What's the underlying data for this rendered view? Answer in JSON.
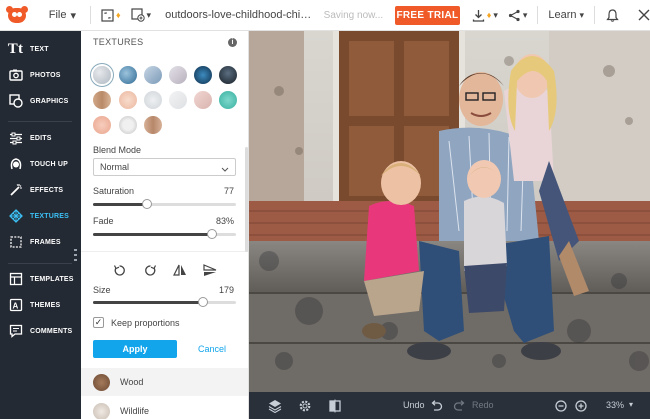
{
  "topbar": {
    "file_label": "File",
    "document_name": "outdoors-love-childhood-child-family...",
    "status": "Saving now...",
    "free_trial_label": "FREE TRIAL",
    "learn_label": "Learn"
  },
  "leftnav": {
    "items": [
      {
        "label": "TEXT",
        "icon": "text-icon",
        "active": false
      },
      {
        "label": "PHOTOS",
        "icon": "photos-icon",
        "active": false
      },
      {
        "label": "GRAPHICS",
        "icon": "graphics-icon",
        "active": false
      },
      {
        "label": "EDITS",
        "icon": "sliders-icon",
        "active": false
      },
      {
        "label": "TOUCH UP",
        "icon": "face-icon",
        "active": false
      },
      {
        "label": "EFFECTS",
        "icon": "wand-icon",
        "active": false
      },
      {
        "label": "TEXTURES",
        "icon": "textures-icon",
        "active": true
      },
      {
        "label": "FRAMES",
        "icon": "frame-icon",
        "active": false
      },
      {
        "label": "TEMPLATES",
        "icon": "templates-icon",
        "active": false
      },
      {
        "label": "THEMES",
        "icon": "themes-icon",
        "active": false
      },
      {
        "label": "COMMENTS",
        "icon": "comments-icon",
        "active": false
      }
    ]
  },
  "panel": {
    "title": "TEXTURES",
    "blend_mode_label": "Blend Mode",
    "blend_mode_value": "Normal",
    "saturation_label": "Saturation",
    "saturation_value": "77",
    "saturation_fraction": 0.38,
    "fade_label": "Fade",
    "fade_value": "83%",
    "fade_fraction": 0.83,
    "size_label": "Size",
    "size_value": "179",
    "size_fraction": 0.77,
    "keep_proportions_label": "Keep proportions",
    "keep_proportions_checked": true,
    "apply_label": "Apply",
    "cancel_label": "Cancel",
    "texture_categories": [
      {
        "label": "Wood",
        "color": "#8a6448"
      },
      {
        "label": "Wildlife",
        "color": "#d8d0c8"
      }
    ],
    "swatches": [
      "#c9cfd6",
      "#5d8fb0",
      "#9bb3cc",
      "#cbc6cf",
      "#1e4f78",
      "#24313d",
      "#c8a083",
      "#f0c9b4",
      "#d9dde2",
      "#e8eaec",
      "#e8c6c2",
      "#58c5b6",
      "#f1bca8",
      "#dcdcdc",
      "#c79f84"
    ]
  },
  "bottombar": {
    "undo_label": "Undo",
    "redo_label": "Redo",
    "zoom_label": "33%"
  },
  "colors": {
    "brand_orange": "#f05a28",
    "accent_blue": "#12a5ec",
    "nav_bg": "#242a33",
    "active_nav": "#3cc0f5"
  }
}
